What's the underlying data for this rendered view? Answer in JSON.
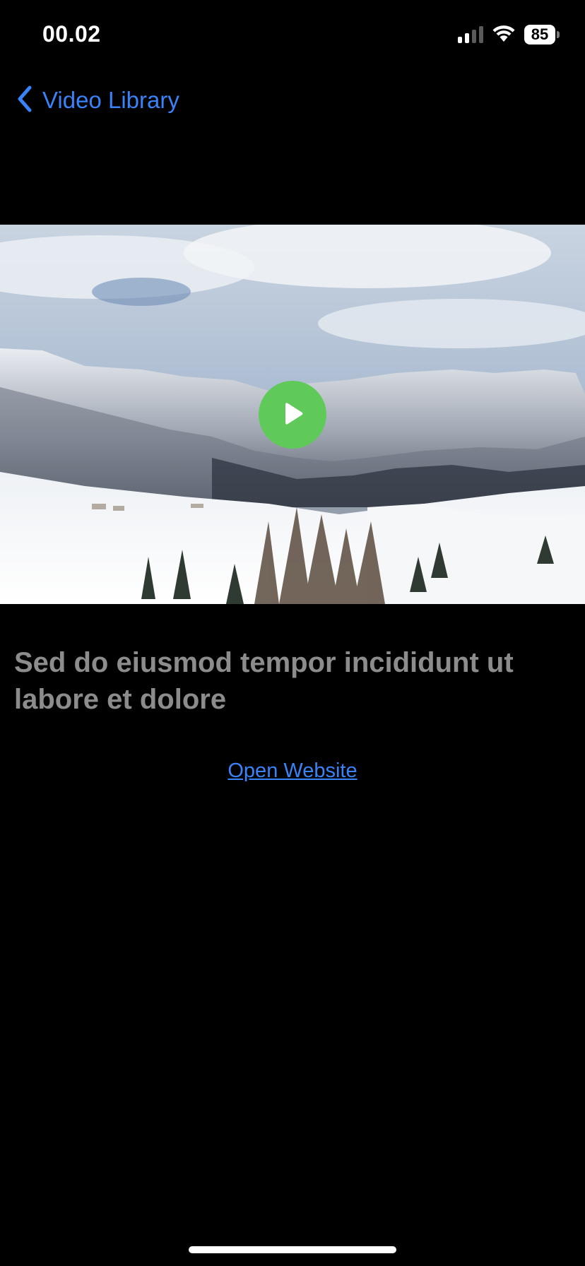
{
  "status_bar": {
    "time": "00.02",
    "battery_level": "85",
    "icons": [
      "signal-icon",
      "wifi-icon",
      "battery-icon"
    ]
  },
  "nav": {
    "back_label": "Video Library",
    "back_icon": "chevron-left-icon"
  },
  "video": {
    "play_icon": "play-icon"
  },
  "content": {
    "caption": "Sed do eiusmod tempor incididunt ut labore et dolore",
    "link_label": "Open Website"
  },
  "colors": {
    "background": "#000000",
    "accent": "#3a82f7",
    "play_button": "#5fc95a",
    "caption_text": "#8c8c8c"
  }
}
